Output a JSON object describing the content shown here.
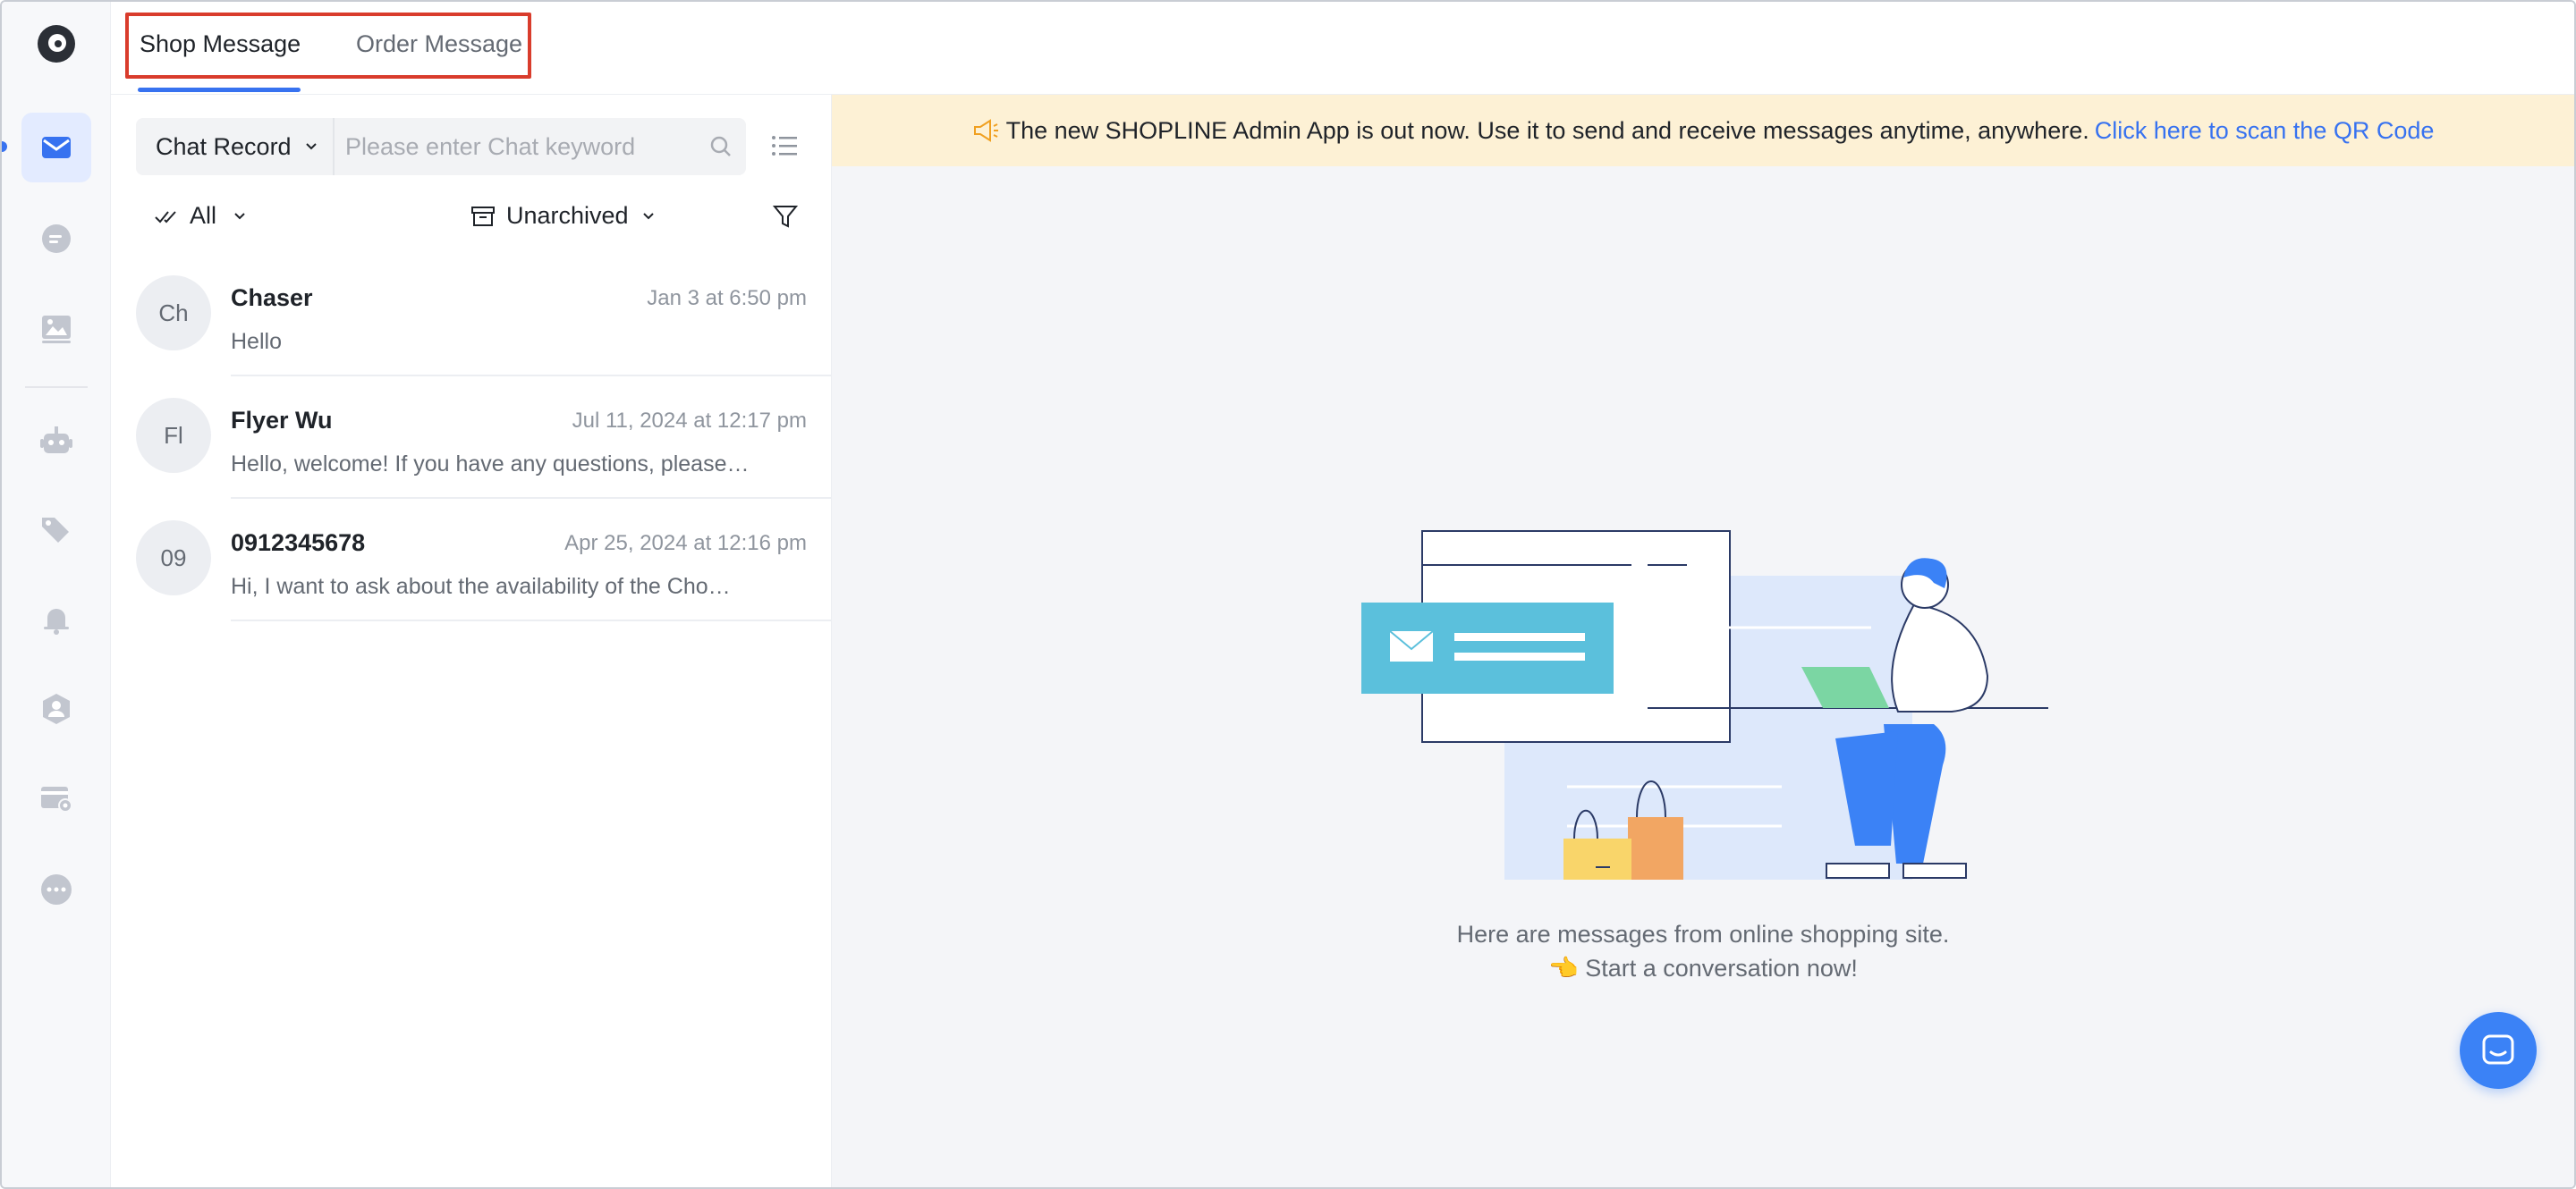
{
  "header": {
    "tabs": [
      {
        "label": "Shop Message",
        "active": true
      },
      {
        "label": "Order Message",
        "active": false
      }
    ]
  },
  "sidebar": {
    "items": [
      {
        "icon": "inbox-icon",
        "active": true
      },
      {
        "icon": "chat-bubble-icon"
      },
      {
        "icon": "image-gallery-icon"
      },
      {
        "icon": "robot-icon"
      },
      {
        "icon": "tags-icon"
      },
      {
        "icon": "bell-icon"
      },
      {
        "icon": "user-badge-icon"
      },
      {
        "icon": "card-settings-icon"
      },
      {
        "icon": "more-icon"
      }
    ]
  },
  "search": {
    "scope_label": "Chat Record",
    "placeholder": "Please enter Chat keyword",
    "value": ""
  },
  "filters": {
    "read_filter": "All",
    "archive_filter": "Unarchived"
  },
  "conversations": [
    {
      "initials": "Ch",
      "name": "Chaser",
      "time": "Jan 3 at 6:50 pm",
      "preview": "Hello"
    },
    {
      "initials": "Fl",
      "name": "Flyer Wu",
      "time": "Jul 11, 2024 at 12:17 pm",
      "preview": "Hello, welcome! If you have any questions, please…"
    },
    {
      "initials": "09",
      "name": "0912345678",
      "time": "Apr 25, 2024 at 12:16 pm",
      "preview": "Hi, I want to ask about the availability of the Cho…"
    }
  ],
  "banner": {
    "text": "The new SHOPLINE Admin App is out now. Use it to send and receive messages anytime, anywhere.",
    "link": "Click here to scan the QR Code"
  },
  "empty_state": {
    "line1": "Here are messages from online shopping site.",
    "line2": "👈 Start a conversation now!"
  },
  "colors": {
    "accent": "#3772f0",
    "highlight_box": "#d93c2c",
    "banner_bg": "#fdf1d5"
  }
}
